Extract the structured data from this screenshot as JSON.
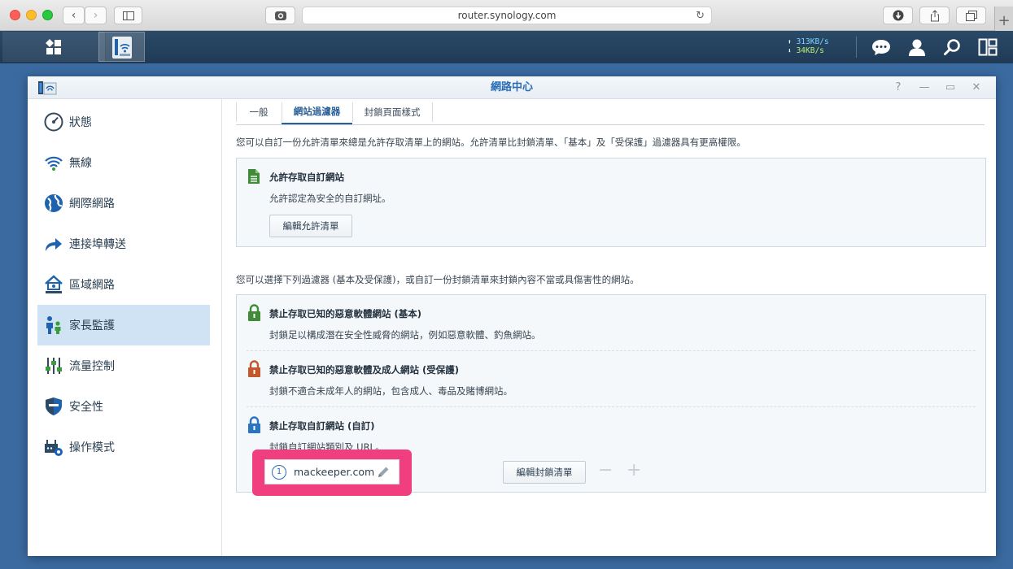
{
  "browser": {
    "url": "router.synology.com",
    "new_tab": "+"
  },
  "taskbar": {
    "upload_speed": "313KB/s",
    "download_speed": "34KB/s"
  },
  "window": {
    "title": "網路中心",
    "controls": [
      "?",
      "—",
      "▭",
      "✕"
    ]
  },
  "sidebar": {
    "items": [
      {
        "label": "狀態",
        "icon": "gauge-icon",
        "active": false
      },
      {
        "label": "無線",
        "icon": "wifi-icon",
        "active": false
      },
      {
        "label": "網際網路",
        "icon": "globe-icon",
        "active": false
      },
      {
        "label": "連接埠轉送",
        "icon": "forward-arrow-icon",
        "active": false
      },
      {
        "label": "區域網路",
        "icon": "home-network-icon",
        "active": false
      },
      {
        "label": "家長監護",
        "icon": "parents-icon",
        "active": true
      },
      {
        "label": "流量控制",
        "icon": "sliders-icon",
        "active": false
      },
      {
        "label": "安全性",
        "icon": "shield-icon",
        "active": false
      },
      {
        "label": "操作模式",
        "icon": "router-gear-icon",
        "active": false
      }
    ]
  },
  "tabs": [
    {
      "label": "一般",
      "active": false
    },
    {
      "label": "網站過濾器",
      "active": true
    },
    {
      "label": "封鎖頁面樣式",
      "active": false
    }
  ],
  "allow_section": {
    "intro": "您可以自訂一份允許清單來總是允許存取清單上的網站。允許清單比封鎖清單、「基本」及「受保護」過濾器具有更高權限。",
    "title": "允許存取自訂網站",
    "description": "允許認定為安全的自訂網址。",
    "button": "編輯允許清單"
  },
  "block_section": {
    "intro": "您可以選擇下列過濾器 (基本及受保護)，或自訂一份封鎖清單來封鎖內容不當或具傷害性的網站。",
    "filters": [
      {
        "title": "禁止存取已知的惡意軟體網站 (基本)",
        "description": "封鎖足以構成潛在安全性威脅的網站，例如惡意軟體、釣魚網站。",
        "lock_color": "#3f8b3a"
      },
      {
        "title": "禁止存取已知的惡意軟體及成人網站 (受保護)",
        "description": "封鎖不適合未成年人的網站，包含成人、毒品及賭博網站。",
        "lock_color": "#c2582b"
      },
      {
        "title": "禁止存取自訂網站 (自訂)",
        "description": "封鎖自訂網站類別及 URL。",
        "lock_color": "#2a74c2"
      }
    ],
    "custom_entry": {
      "number": "1",
      "domain": "mackeeper.com"
    },
    "button": "編輯封鎖清單",
    "minus": "−",
    "plus": "+"
  },
  "colors": {
    "accent": "#2a6db5",
    "highlight": "#f03e7e",
    "taskbar": "#1f3a55"
  }
}
